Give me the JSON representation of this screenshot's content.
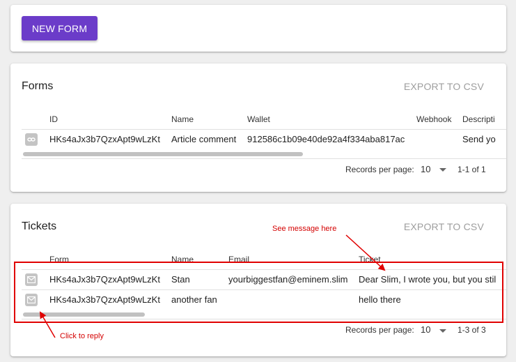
{
  "top": {
    "new_form_label": "NEW FORM"
  },
  "forms": {
    "title": "Forms",
    "export_label": "EXPORT TO CSV",
    "columns": [
      "ID",
      "Name",
      "Wallet",
      "Webhook",
      "Descripti"
    ],
    "rows": [
      {
        "icon": "link-icon",
        "id": "HKs4aJx3b7QzxApt9wLzKt",
        "name": "Article comment",
        "wallet": "912586c1b09e40de92a4f334aba817ac",
        "webhook": "",
        "description": "Send yo"
      }
    ],
    "pager": {
      "label": "Records per page:",
      "value": "10",
      "range": "1-1 of 1"
    }
  },
  "tickets": {
    "title": "Tickets",
    "export_label": "EXPORT TO CSV",
    "columns": [
      "Form",
      "Name",
      "Email",
      "Ticket"
    ],
    "rows": [
      {
        "icon": "mail-icon",
        "form": "HKs4aJx3b7QzxApt9wLzKt",
        "name": "Stan",
        "email": "yourbiggestfan@eminem.slim",
        "ticket": "Dear Slim, I wrote you, but you stil"
      },
      {
        "icon": "mail-icon",
        "form": "HKs4aJx3b7QzxApt9wLzKt",
        "name": "another fan",
        "email": "",
        "ticket": "hello there"
      }
    ],
    "pager": {
      "label": "Records per page:",
      "value": "10",
      "range": "1-3 of 3"
    }
  },
  "annotations": {
    "see_message": "See message here",
    "click_reply": "Click to reply"
  },
  "colors": {
    "primary": "#6b3cc9",
    "annotation": "#e00000"
  }
}
